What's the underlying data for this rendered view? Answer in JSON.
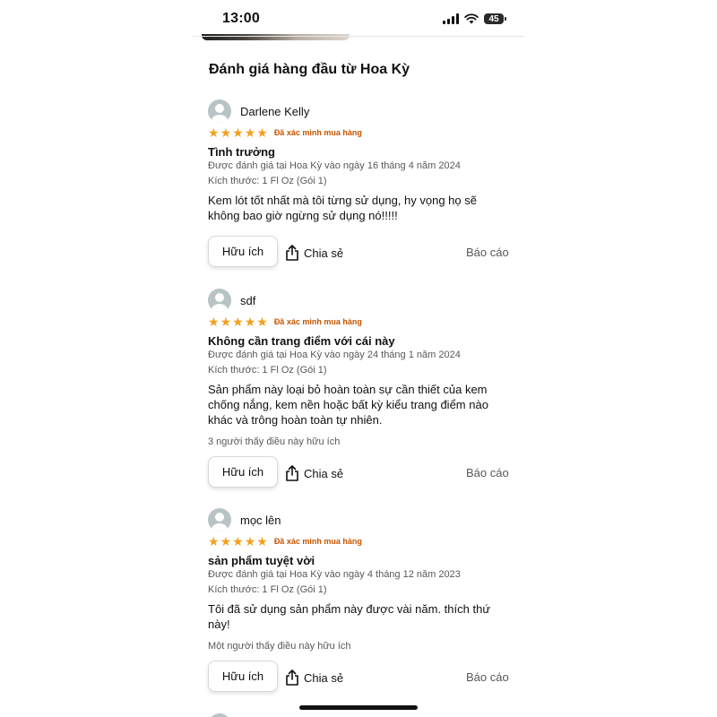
{
  "status_bar": {
    "time": "13:00",
    "battery": "45"
  },
  "section_title": "Đánh giá hàng đầu từ Hoa Kỳ",
  "reviews": [
    {
      "name": "Darlene Kelly",
      "rating": 5,
      "verified": "Đã xác minh mua hàng",
      "title": "Tình trưởng",
      "date": "Được đánh giá tại Hoa Kỳ vào ngày 16 tháng 4 năm 2024",
      "size": "Kích thước: 1 Fl Oz (Gói 1)",
      "body": "Kem lót tốt nhất mà tôi từng sử dụng, hy vọng họ sẽ không bao giờ ngừng sử dụng nó!!!!!",
      "helpful_count": "",
      "helpful_label": "Hữu ích",
      "share_label": "Chia sẻ",
      "report_label": "Báo cáo"
    },
    {
      "name": "sdf",
      "rating": 5,
      "verified": "Đã xác minh mua hàng",
      "title": "Không cần trang điểm với cái này",
      "date": "Được đánh giá tại Hoa Kỳ vào ngày 24 tháng 1 năm 2024",
      "size": "Kích thước: 1 Fl Oz (Gói 1)",
      "body": "Sản phẩm này loại bỏ hoàn toàn sự cần thiết của kem chống nắng, kem nền hoặc bất kỳ kiểu trang điểm nào khác và trông hoàn toàn tự nhiên.",
      "helpful_count": "3 người thấy điều này hữu ích",
      "helpful_label": "Hữu ích",
      "share_label": "Chia sẻ",
      "report_label": "Báo cáo"
    },
    {
      "name": "mọc lên",
      "rating": 5,
      "verified": "Đã xác minh mua hàng",
      "title": "sản phẩm tuyệt vời",
      "date": "Được đánh giá tại Hoa Kỳ vào ngày 4 tháng 12 năm 2023",
      "size": "Kích thước: 1 Fl Oz (Gói 1)",
      "body": "Tôi đã sử dụng sản phẩm này được vài năm. thích thứ này!",
      "helpful_count": "Một người thấy điều này hữu ích",
      "helpful_label": "Hữu ích",
      "share_label": "Chia sẻ",
      "report_label": "Báo cáo"
    }
  ],
  "colors": {
    "star": "#f49f1c",
    "verified": "#c45500",
    "text": "#0f1111",
    "muted": "#565959"
  },
  "icons": [
    "signal-icon",
    "wifi-icon",
    "battery-icon",
    "avatar-icon",
    "star-icon",
    "share-icon"
  ]
}
